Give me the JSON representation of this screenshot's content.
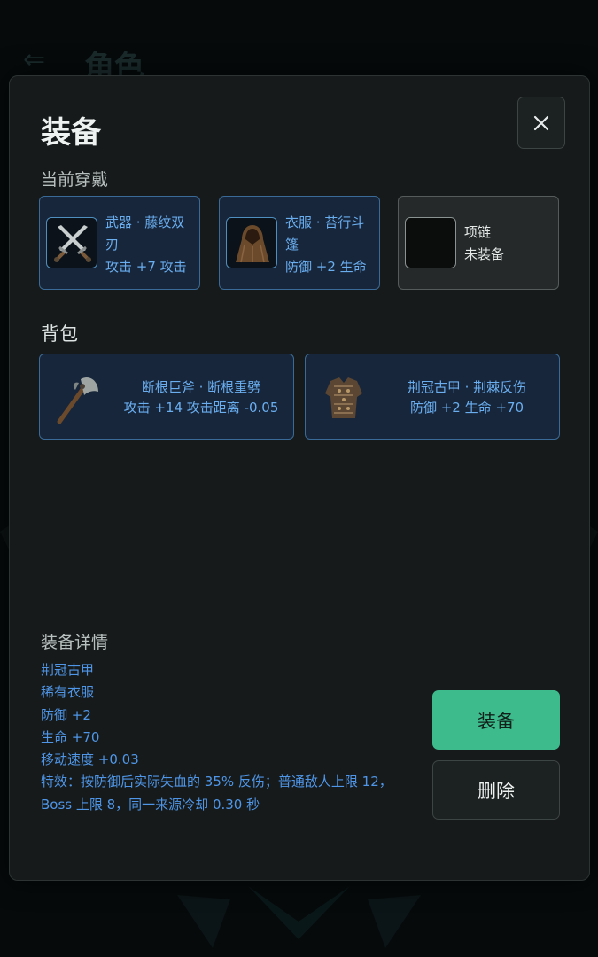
{
  "background": {
    "back_icon": "arrow-left-icon",
    "title": "角色"
  },
  "dialog": {
    "title": "装备",
    "close_icon": "close-icon"
  },
  "current": {
    "label": "当前穿戴",
    "slots": [
      {
        "name": "武器 · 藤纹双刃",
        "stat": "攻击 +7 攻击",
        "icon": "crossed-blades-icon"
      },
      {
        "name": "衣服 · 苔行斗篷",
        "stat": "防御 +2 生命",
        "icon": "hooded-cloak-icon"
      },
      {
        "name": "项链",
        "stat": "未装备",
        "icon": "empty-slot-icon"
      }
    ]
  },
  "bag": {
    "label": "背包",
    "items": [
      {
        "name": "断根巨斧 · 断根重劈",
        "stat": "攻击 +14 攻击距离 -0.05",
        "icon": "battle-axe-icon"
      },
      {
        "name": "荆冠古甲 · 荆棘反伤",
        "stat": "防御 +2 生命 +70",
        "icon": "armor-icon"
      }
    ]
  },
  "details": {
    "title": "装备详情",
    "lines": [
      "荆冠古甲",
      "稀有衣服",
      "防御 +2",
      "生命 +70",
      "移动速度 +0.03",
      "特效：按防御后实际失血的 35% 反伤；普通敌人上限 12，",
      "Boss 上限 8，同一来源冷却 0.30 秒"
    ]
  },
  "actions": {
    "equip": "装备",
    "delete": "删除"
  },
  "colors": {
    "accent_green": "#3dbb8d",
    "item_blue": "#4f96e8",
    "card_border": "#3a6b98"
  }
}
